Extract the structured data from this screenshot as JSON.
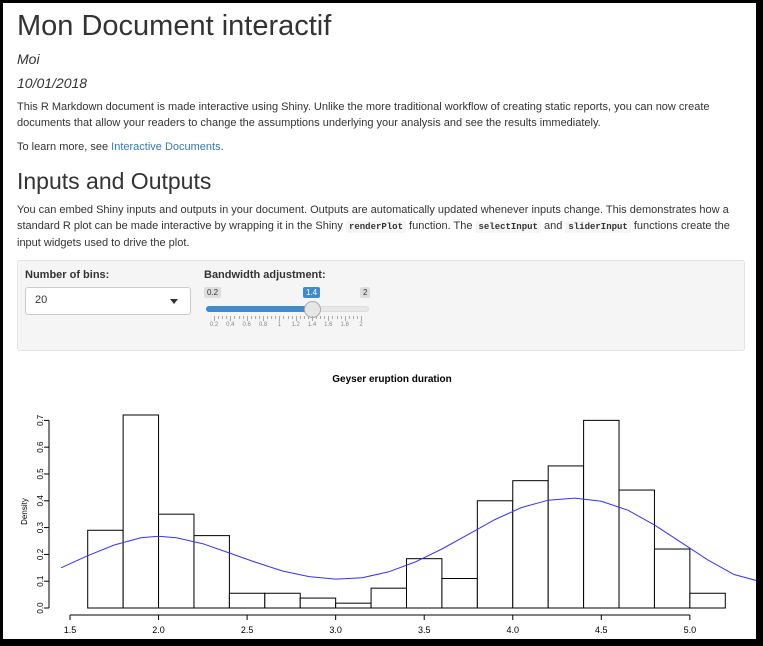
{
  "doc": {
    "title": "Mon Document interactif",
    "author": "Moi",
    "date": "10/01/2018",
    "intro": "This R Markdown document is made interactive using Shiny. Unlike the more traditional workflow of creating static reports, you can now create documents that allow your readers to change the assumptions underlying your analysis and see the results immediately.",
    "learn_prefix": "To learn more, see ",
    "learn_link": "Interactive Documents",
    "learn_suffix": "."
  },
  "section": {
    "heading": "Inputs and Outputs",
    "p1": "You can embed Shiny inputs and outputs in your document. Outputs are automatically updated whenever inputs change. This demonstrates how a standard R plot can be made interactive by wrapping it in the Shiny ",
    "code1": "renderPlot",
    "p2": " function. The ",
    "code2": "selectInput",
    "p3": " and ",
    "code3": "sliderInput",
    "p4": " functions create the input widgets used to drive the plot."
  },
  "inputs": {
    "bins_label": "Number of bins:",
    "bins_value": "20",
    "bw_label": "Bandwidth adjustment:",
    "bw_min": "0.2",
    "bw_max": "2",
    "bw_value": "1.4",
    "bw_min_num": 0.2,
    "bw_max_num": 2,
    "bw_value_num": 1.4,
    "bw_ticks": [
      "0.2",
      "0.4",
      "0.6",
      "0.8",
      "1",
      "1.2",
      "1.4",
      "1.6",
      "1.8",
      "2"
    ]
  },
  "chart_data": {
    "type": "bar",
    "title": "Geyser eruption duration",
    "xlabel": "",
    "ylabel": "Density",
    "xlim": [
      1.5,
      5.3
    ],
    "ylim": [
      0,
      0.72
    ],
    "xticks": [
      "1.5",
      "2.0",
      "2.5",
      "3.0",
      "3.5",
      "4.0",
      "4.5",
      "5.0"
    ],
    "yticks": [
      "0.0",
      "0.1",
      "0.2",
      "0.3",
      "0.4",
      "0.5",
      "0.6",
      "0.7"
    ],
    "bin_edges": [
      1.6,
      1.8,
      2.0,
      2.2,
      2.4,
      2.6,
      2.8,
      3.0,
      3.2,
      3.4,
      3.6,
      3.8,
      4.0,
      4.2,
      4.4,
      4.6,
      4.8,
      5.0,
      5.2
    ],
    "values": [
      0.29,
      0.72,
      0.35,
      0.27,
      0.055,
      0.055,
      0.037,
      0.018,
      0.074,
      0.184,
      0.11,
      0.4,
      0.475,
      0.53,
      0.7,
      0.44,
      0.22,
      0.055
    ],
    "density_line": {
      "color": "#3333ff",
      "x": [
        1.45,
        1.6,
        1.75,
        1.9,
        2.0,
        2.1,
        2.25,
        2.4,
        2.55,
        2.7,
        2.85,
        3.0,
        3.15,
        3.3,
        3.45,
        3.6,
        3.75,
        3.9,
        4.05,
        4.2,
        4.35,
        4.5,
        4.65,
        4.8,
        4.95,
        5.1,
        5.25,
        5.4
      ],
      "y": [
        0.15,
        0.195,
        0.235,
        0.262,
        0.268,
        0.262,
        0.24,
        0.205,
        0.17,
        0.138,
        0.117,
        0.108,
        0.113,
        0.135,
        0.172,
        0.22,
        0.275,
        0.33,
        0.375,
        0.402,
        0.41,
        0.398,
        0.365,
        0.31,
        0.245,
        0.18,
        0.125,
        0.098
      ]
    }
  }
}
